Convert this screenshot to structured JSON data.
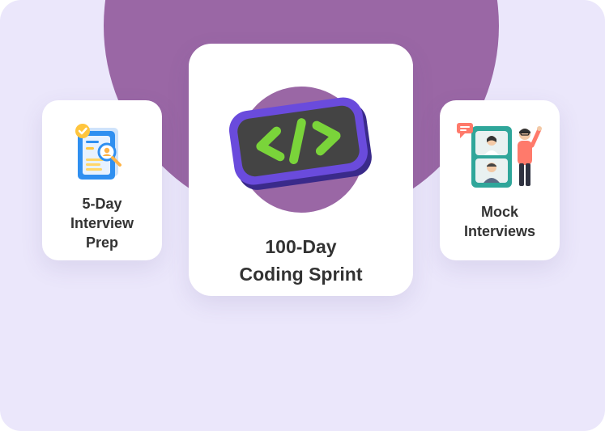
{
  "cards": [
    {
      "label_line1": "5-Day",
      "label_line2": "Interview",
      "label_line3": "Prep",
      "icon": "resume-search-icon"
    },
    {
      "label_line1": "100-Day",
      "label_line2": "Coding Sprint",
      "icon": "code-brackets-icon"
    },
    {
      "label_line1": "Mock",
      "label_line2": "Interviews",
      "icon": "video-interview-icon"
    }
  ],
  "colors": {
    "background": "#ebe7fb",
    "accent_circle": "#9a67a5",
    "card": "#ffffff",
    "text": "#333333",
    "code_badge_border": "#6a4bdc",
    "code_symbol": "#7ad43a"
  }
}
